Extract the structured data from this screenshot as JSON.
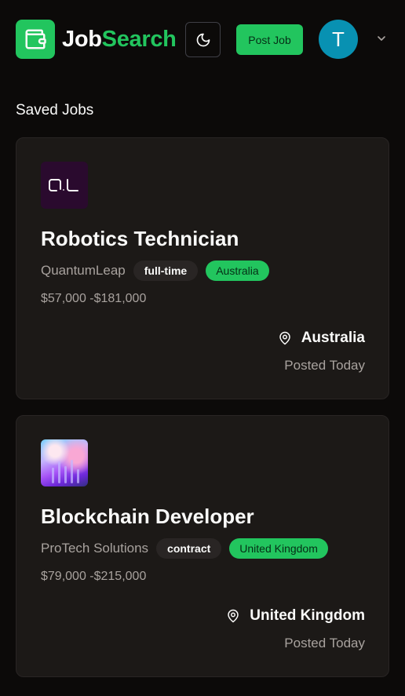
{
  "header": {
    "brand_part1": "Job",
    "brand_part2": "Search",
    "post_job_label": "Post Job",
    "avatar_initial": "T",
    "brand_color": "#22c55e",
    "avatar_color": "#0891b2"
  },
  "main": {
    "section_title": "Saved Jobs",
    "jobs": [
      {
        "logo_icon": "quantumleap-logo",
        "title": "Robotics Technician",
        "company": "QuantumLeap",
        "type": "full-time",
        "location_tag": "Australia",
        "salary": "$57,000 -$181,000",
        "location": "Australia",
        "posted": "Posted Today"
      },
      {
        "logo_icon": "protech-solutions-logo",
        "title": "Blockchain Developer",
        "company": "ProTech Solutions",
        "type": "contract",
        "location_tag": "United Kingdom",
        "salary": "$79,000 -$215,000",
        "location": "United Kingdom",
        "posted": "Posted Today"
      }
    ]
  }
}
